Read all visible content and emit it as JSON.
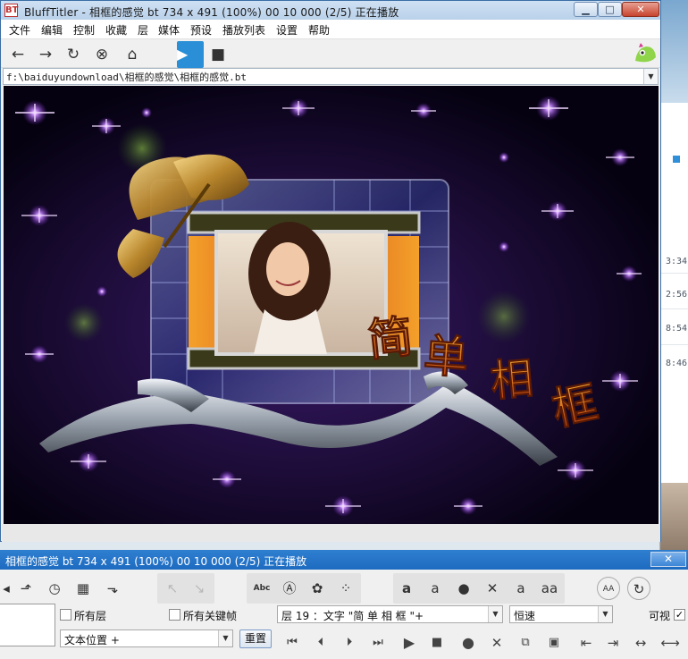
{
  "window": {
    "title": "BluffTitler - 相框的感觉 bt 734 x 491 (100%) 00 10 000 (2/5) 正在播放",
    "app_icon": "BT",
    "min_glyph": "▁",
    "max_glyph": "□",
    "close_glyph": "✕"
  },
  "menu": {
    "items": [
      "文件",
      "编辑",
      "控制",
      "收藏",
      "层",
      "媒体",
      "预设",
      "播放列表",
      "设置",
      "帮助"
    ]
  },
  "toolbar": {
    "back_glyph": "←",
    "forward_glyph": "→",
    "refresh_glyph": "↻",
    "cancel_glyph": "⊗",
    "home_glyph": "⌂",
    "play_glyph": "▶",
    "stop_glyph": "■"
  },
  "path": {
    "value": "f:\\baiduyundownload\\相框的感觉\\相框的感觉.bt",
    "dropdown_glyph": "▼"
  },
  "viewport": {
    "overlay_text": [
      "简",
      "单",
      "相",
      "框"
    ]
  },
  "background_window": {
    "times": [
      "3:34",
      "2:56",
      "8:54",
      "8:46"
    ]
  },
  "panel": {
    "title": "相框的感觉 bt 734 x 491 (100%) 00 10 000 (2/5) 正在播放",
    "close_glyph": "✕",
    "abc_label": "Abc",
    "aa_label": "AA",
    "all_layers_label": "所有层",
    "all_keyframes_label": "所有关键帧",
    "property_combo": "文本位置 +",
    "reset_button": "重置",
    "layer_combo": "层   19  ：文字 \"简 单 相 框      \"+",
    "speed_combo": "恒速",
    "visible_label": "可视",
    "visible_checked": true,
    "all_layers_checked": false,
    "all_keyframes_checked": false,
    "combo_dropdown_glyph": "▼",
    "transport": {
      "first": "⏮",
      "prev": "⏴",
      "next": "⏵",
      "last": "⏭",
      "play": "▶",
      "stop": "■",
      "record": "●",
      "delete": "✕"
    },
    "align": {
      "left": "⇤",
      "right": "⇥",
      "stretch": "↔",
      "center": "⟷"
    }
  },
  "colors": {
    "accent": "#2a8fd6",
    "panel_bar": "#2576c9",
    "title_gold": "#e06a10"
  }
}
